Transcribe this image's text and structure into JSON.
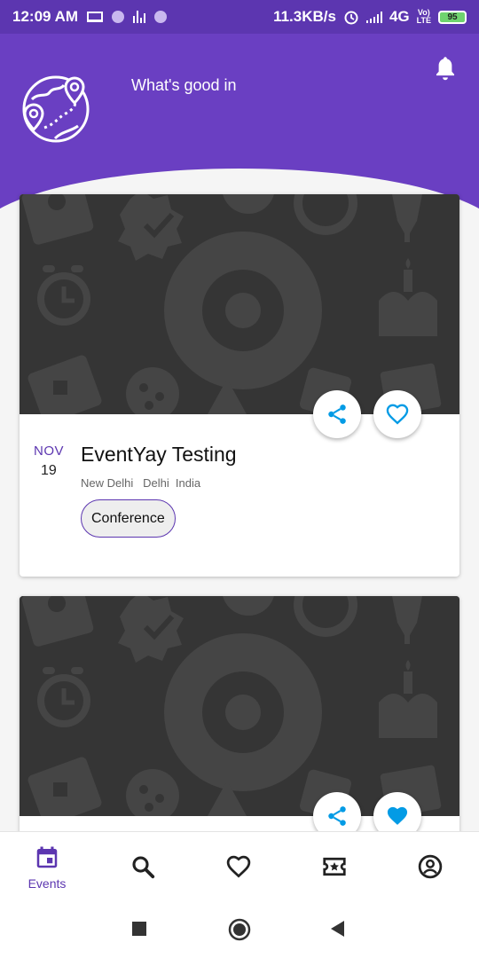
{
  "status_bar": {
    "time": "12:09 AM",
    "network_speed": "11.3KB/s",
    "network_type": "4G",
    "volte_top": "Vo)",
    "volte_bottom": "LTE",
    "battery": "95"
  },
  "header": {
    "title": "What's good in"
  },
  "events": [
    {
      "month": "NOV",
      "day": "19",
      "title": "EventYay Testing",
      "location": "New Delhi   Delhi  India",
      "tag": "Conference",
      "favorited": false
    },
    {
      "favorited": true
    }
  ],
  "bottom_nav": {
    "items": [
      {
        "label": "Events",
        "icon": "calendar-icon",
        "active": true
      },
      {
        "label": "",
        "icon": "search-icon",
        "active": false
      },
      {
        "label": "",
        "icon": "heart-icon",
        "active": false
      },
      {
        "label": "",
        "icon": "ticket-icon",
        "active": false
      },
      {
        "label": "",
        "icon": "account-icon",
        "active": false
      }
    ]
  },
  "colors": {
    "primary": "#6a3fc2",
    "primary_dark": "#5c36b0",
    "accent": "#039be5",
    "card_image_bg": "#353535"
  }
}
